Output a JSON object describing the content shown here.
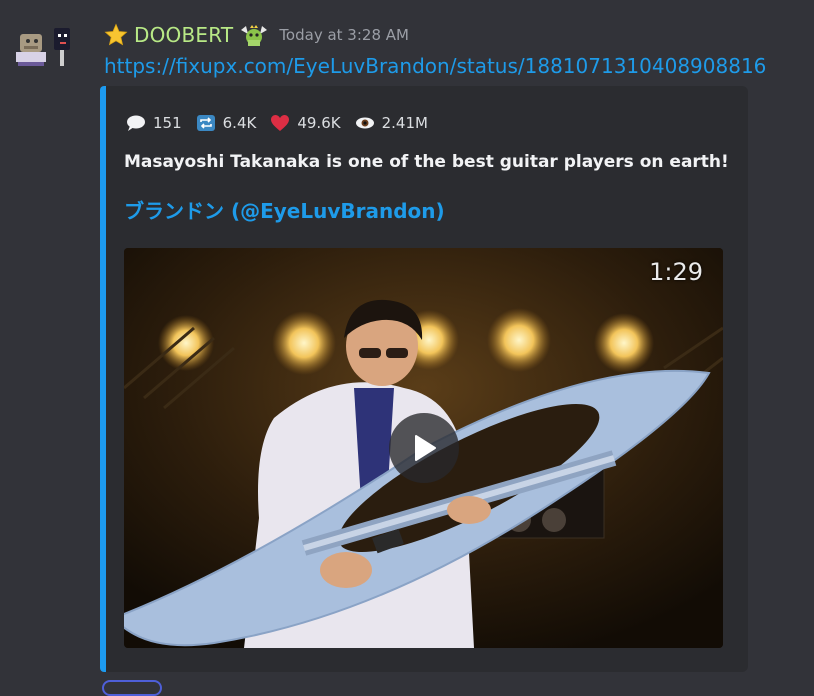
{
  "message": {
    "username": "DOOBERT",
    "timestamp": "Today at 3:28 AM",
    "link_text": "https://fixupx.com/EyeLuvBrandon/status/1881071310408908816",
    "icons": {
      "avatar": "pixel-art-avatar",
      "badge": "star-icon",
      "role": "winged-creature-icon"
    },
    "username_color": "#b8e986"
  },
  "embed": {
    "accent_color": "#1d9bf0",
    "stats": {
      "replies": "151",
      "retweets": "6.4K",
      "likes": "49.6K",
      "views": "2.41M"
    },
    "description": "Masayoshi Takanaka is one of the best guitar players on earth!",
    "author": "ブランドン (@EyeLuvBrandon)",
    "video": {
      "duration": "1:29",
      "play_icon": "play-icon"
    }
  }
}
